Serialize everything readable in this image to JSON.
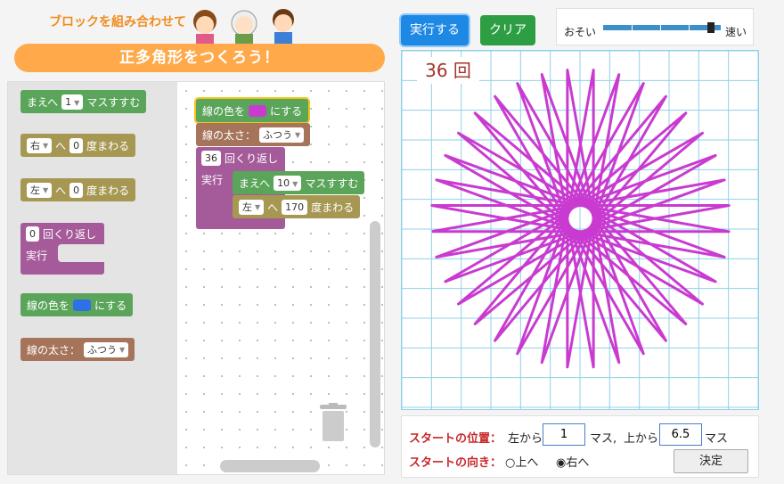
{
  "header": {
    "subtitle": "ブロックを組み合わせて",
    "banner": "正多角形をつくろう！"
  },
  "palette": {
    "move_block": {
      "label_before": "まえへ",
      "value": "1",
      "label_after": "マスすすむ"
    },
    "turn_right_block": {
      "dir": "右",
      "label_mid": "へ",
      "value": "0",
      "label_after": "度まわる"
    },
    "turn_left_block": {
      "dir": "左",
      "label_mid": "へ",
      "value": "0",
      "label_after": "度まわる"
    },
    "repeat_block": {
      "value": "0",
      "label": "回くり返し",
      "do_label": "実行"
    },
    "color_block": {
      "label_before": "線の色を",
      "label_after": "にする",
      "color": "#2f6fe8"
    },
    "width_block": {
      "label": "線の太さ：",
      "value": "ふつう"
    }
  },
  "program": {
    "color_block": {
      "label_before": "線の色を",
      "label_after": "にする",
      "color": "#c93bd0"
    },
    "width_block": {
      "label": "線の太さ：",
      "value": "ふつう"
    },
    "repeat_block": {
      "value": "36",
      "label": "回くり返し",
      "do_label": "実行"
    },
    "move_block": {
      "label_before": "まえへ",
      "value": "10",
      "label_after": "マスすすむ"
    },
    "turn_block": {
      "dir": "左",
      "label_mid": "へ",
      "value": "170",
      "label_after": "度まわる"
    }
  },
  "controls": {
    "run_label": "実行する",
    "clear_label": "クリア",
    "speed_slow": "おそい",
    "speed_fast": "速い",
    "speed_level": 0.95
  },
  "stage": {
    "count_value": "36",
    "count_unit": "回",
    "star_repeats": 36,
    "star_step": 10,
    "star_turn": 170,
    "line_color": "#c93bd0",
    "grid_color": "#8fd0ea"
  },
  "settings": {
    "position_label": "スタートの位置：",
    "from_left": "左から",
    "x_value": "1",
    "unit1": "マス,",
    "from_top": "上から",
    "y_value": "6.5",
    "unit2": "マス",
    "direction_label": "スタートの向き：",
    "option_up": "上へ",
    "option_right": "右へ",
    "selected": "右へ",
    "decide_label": "決定"
  }
}
